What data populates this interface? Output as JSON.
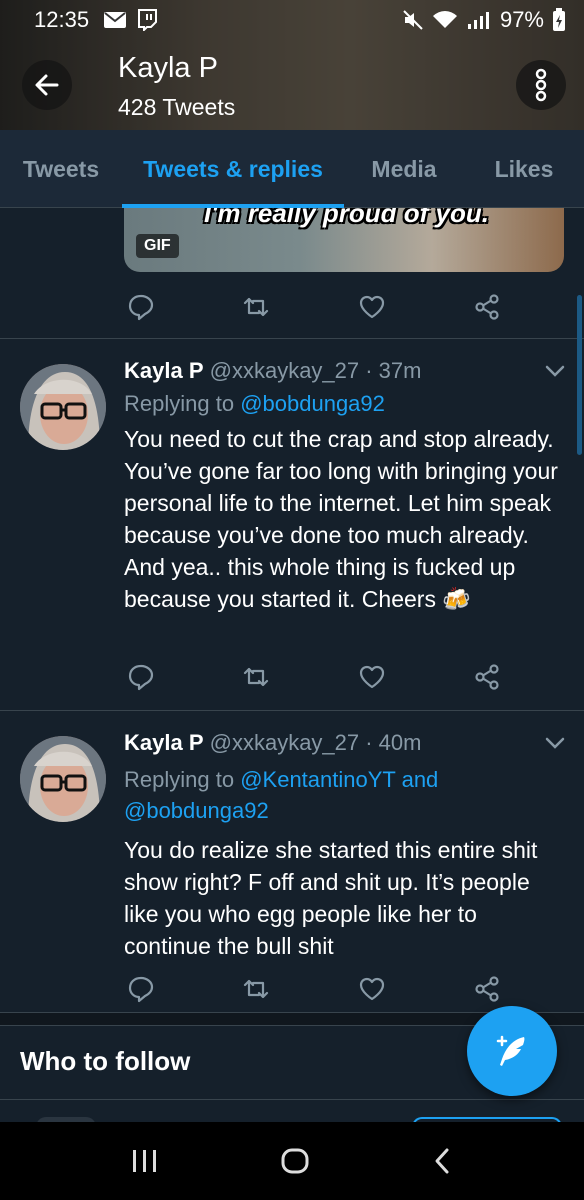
{
  "status_bar": {
    "time": "12:35",
    "battery": "97%",
    "icons": [
      "mail-icon",
      "twitch-icon",
      "mute-icon",
      "wifi-icon",
      "signal-icon",
      "battery-icon"
    ]
  },
  "header": {
    "name": "Kayla P",
    "tweet_count": "428 Tweets"
  },
  "tabs": [
    {
      "label": "Tweets",
      "active": false
    },
    {
      "label": "Tweets & replies",
      "active": true
    },
    {
      "label": "Media",
      "active": false
    },
    {
      "label": "Likes",
      "active": false
    }
  ],
  "gif_card": {
    "caption": "I'm really proud of you.",
    "badge": "GIF"
  },
  "tweets": [
    {
      "name": "Kayla P",
      "handle_time": "@xxkaykay_27 · 37m",
      "replying_prefix": "Replying to",
      "replying_to_1": "@bobdunga92",
      "replying_and": "",
      "replying_to_2": "",
      "text": "You need to cut the crap and stop already. You’ve gone far too long with bringing your personal life to the internet. Let him speak because you’ve done too much already. And yea.. this whole thing is fucked up because you started it. Cheers 🍻"
    },
    {
      "name": "Kayla P",
      "handle_time": "@xxkaykay_27 · 40m",
      "replying_prefix": "Replying to",
      "replying_to_1": "@KentantinoYT",
      "replying_and": "and",
      "replying_to_2": "@bobdunga92",
      "text": "You do realize she started this entire shit show right? F off and shit up. It’s people like you who egg people like her to continue the bull shit"
    }
  ],
  "who_to_follow": {
    "title": "Who to follow"
  },
  "colors": {
    "background": "#15202b",
    "accent": "#1da1f2",
    "muted": "#8899a6",
    "divider": "#38444d"
  }
}
